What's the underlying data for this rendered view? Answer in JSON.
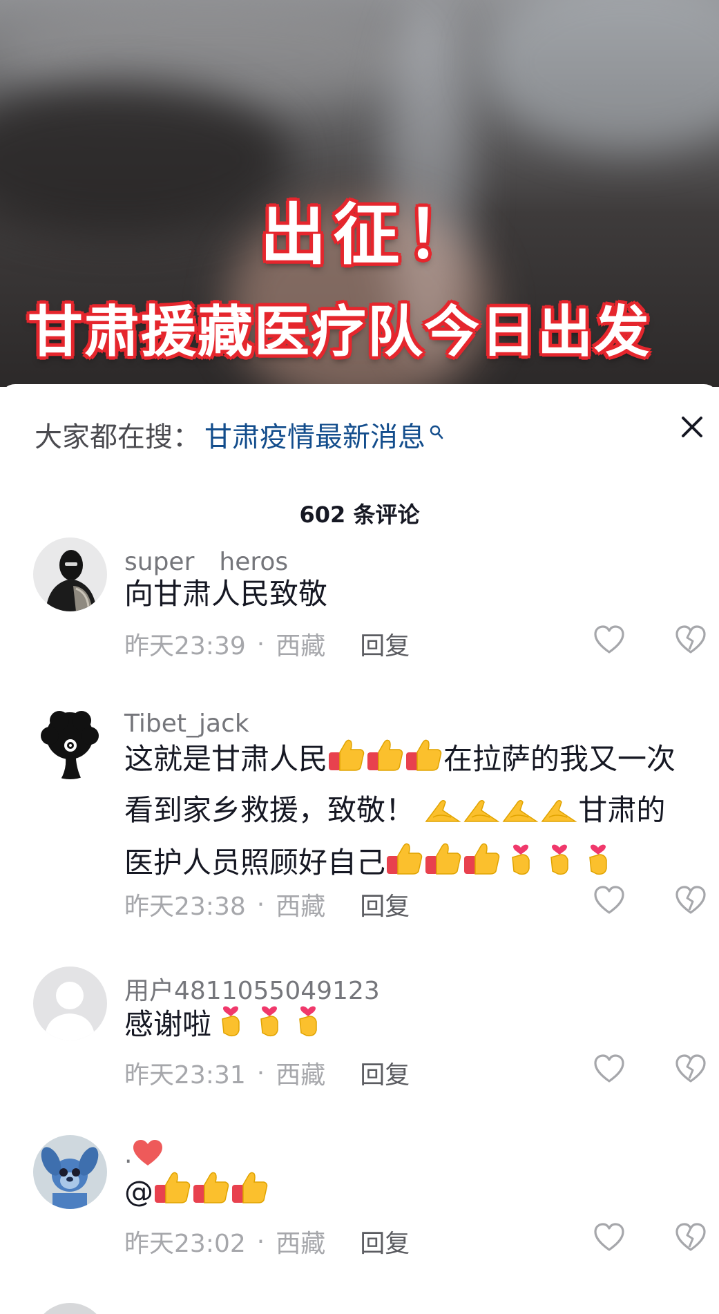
{
  "video": {
    "caption_line1": "出征！",
    "caption_line2": "甘肃援藏医疗队今日出发"
  },
  "hot_search": {
    "label": "大家都在搜：",
    "term": "甘肃疫情最新消息",
    "icon": "search-icon"
  },
  "close_icon": "close-icon",
  "comment_count": "602 条评论",
  "comments": [
    {
      "username": "super　heros",
      "avatar": "masked-person-photo",
      "text_lines": [
        "向甘肃人民致敬"
      ],
      "time": "昨天23:39",
      "location": "西藏",
      "reply": "回复"
    },
    {
      "username": "Tibet_jack",
      "avatar": "afro-silhouette-headphones",
      "text_lines": [
        "这就是甘肃人民",
        "在拉萨的我又一次",
        "看到家乡救援，致敬！",
        "甘肃的",
        "医护人员照顾好自己"
      ],
      "emoji": [
        "thumbs-up",
        "folded-hands",
        "finger-heart"
      ],
      "time": "昨天23:38",
      "location": "西藏",
      "reply": "回复"
    },
    {
      "username": "用户4811055049123",
      "avatar": "default-avatar",
      "text_lines": [
        "感谢啦"
      ],
      "time": "昨天23:31",
      "location": "西藏",
      "reply": "回复"
    },
    {
      "username": ".",
      "avatar": "stitch-cartoon",
      "text_lines": [
        "@"
      ],
      "time": "昨天23:02",
      "location": "西藏",
      "reply": "回复"
    }
  ],
  "colors": {
    "link": "#134d8c",
    "caption_outline": "#e5262d",
    "meta_text": "#a6a7ab"
  }
}
